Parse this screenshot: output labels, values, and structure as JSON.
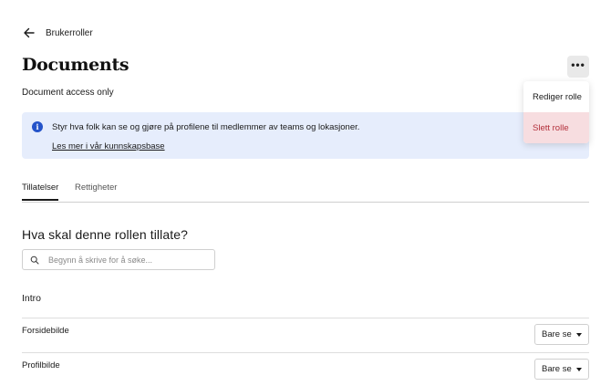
{
  "header": {
    "breadcrumb": "Brukerroller",
    "title": "Documents",
    "subtitle": "Document access only"
  },
  "menu": {
    "items": [
      "Rediger rolle",
      "Slett rolle"
    ]
  },
  "banner": {
    "text": "Styr hva folk kan se og gjøre på profilene til medlemmer av teams og lokasjoner.",
    "link": "Les mer i vår kunnskapsbase"
  },
  "tabs": [
    {
      "label": "Tillatelser",
      "active": true
    },
    {
      "label": "Rettigheter",
      "active": false
    }
  ],
  "permissions": {
    "heading": "Hva skal denne rollen tillate?",
    "search_placeholder": "Begynn å skrive for å søke...",
    "group_title": "Intro",
    "rows": [
      {
        "label": "Forsidebilde",
        "value": "Bare se"
      },
      {
        "label": "Profilbilde",
        "value": "Bare se"
      }
    ]
  },
  "colors": {
    "banner_bg": "#e6edfc",
    "info_icon": "#2453c9",
    "delete_text": "#b3303b",
    "delete_bg": "#f7dde0"
  },
  "icons": [
    "arrow-left-icon",
    "more-horizontal-icon",
    "info-icon",
    "search-icon",
    "caret-down-icon"
  ]
}
